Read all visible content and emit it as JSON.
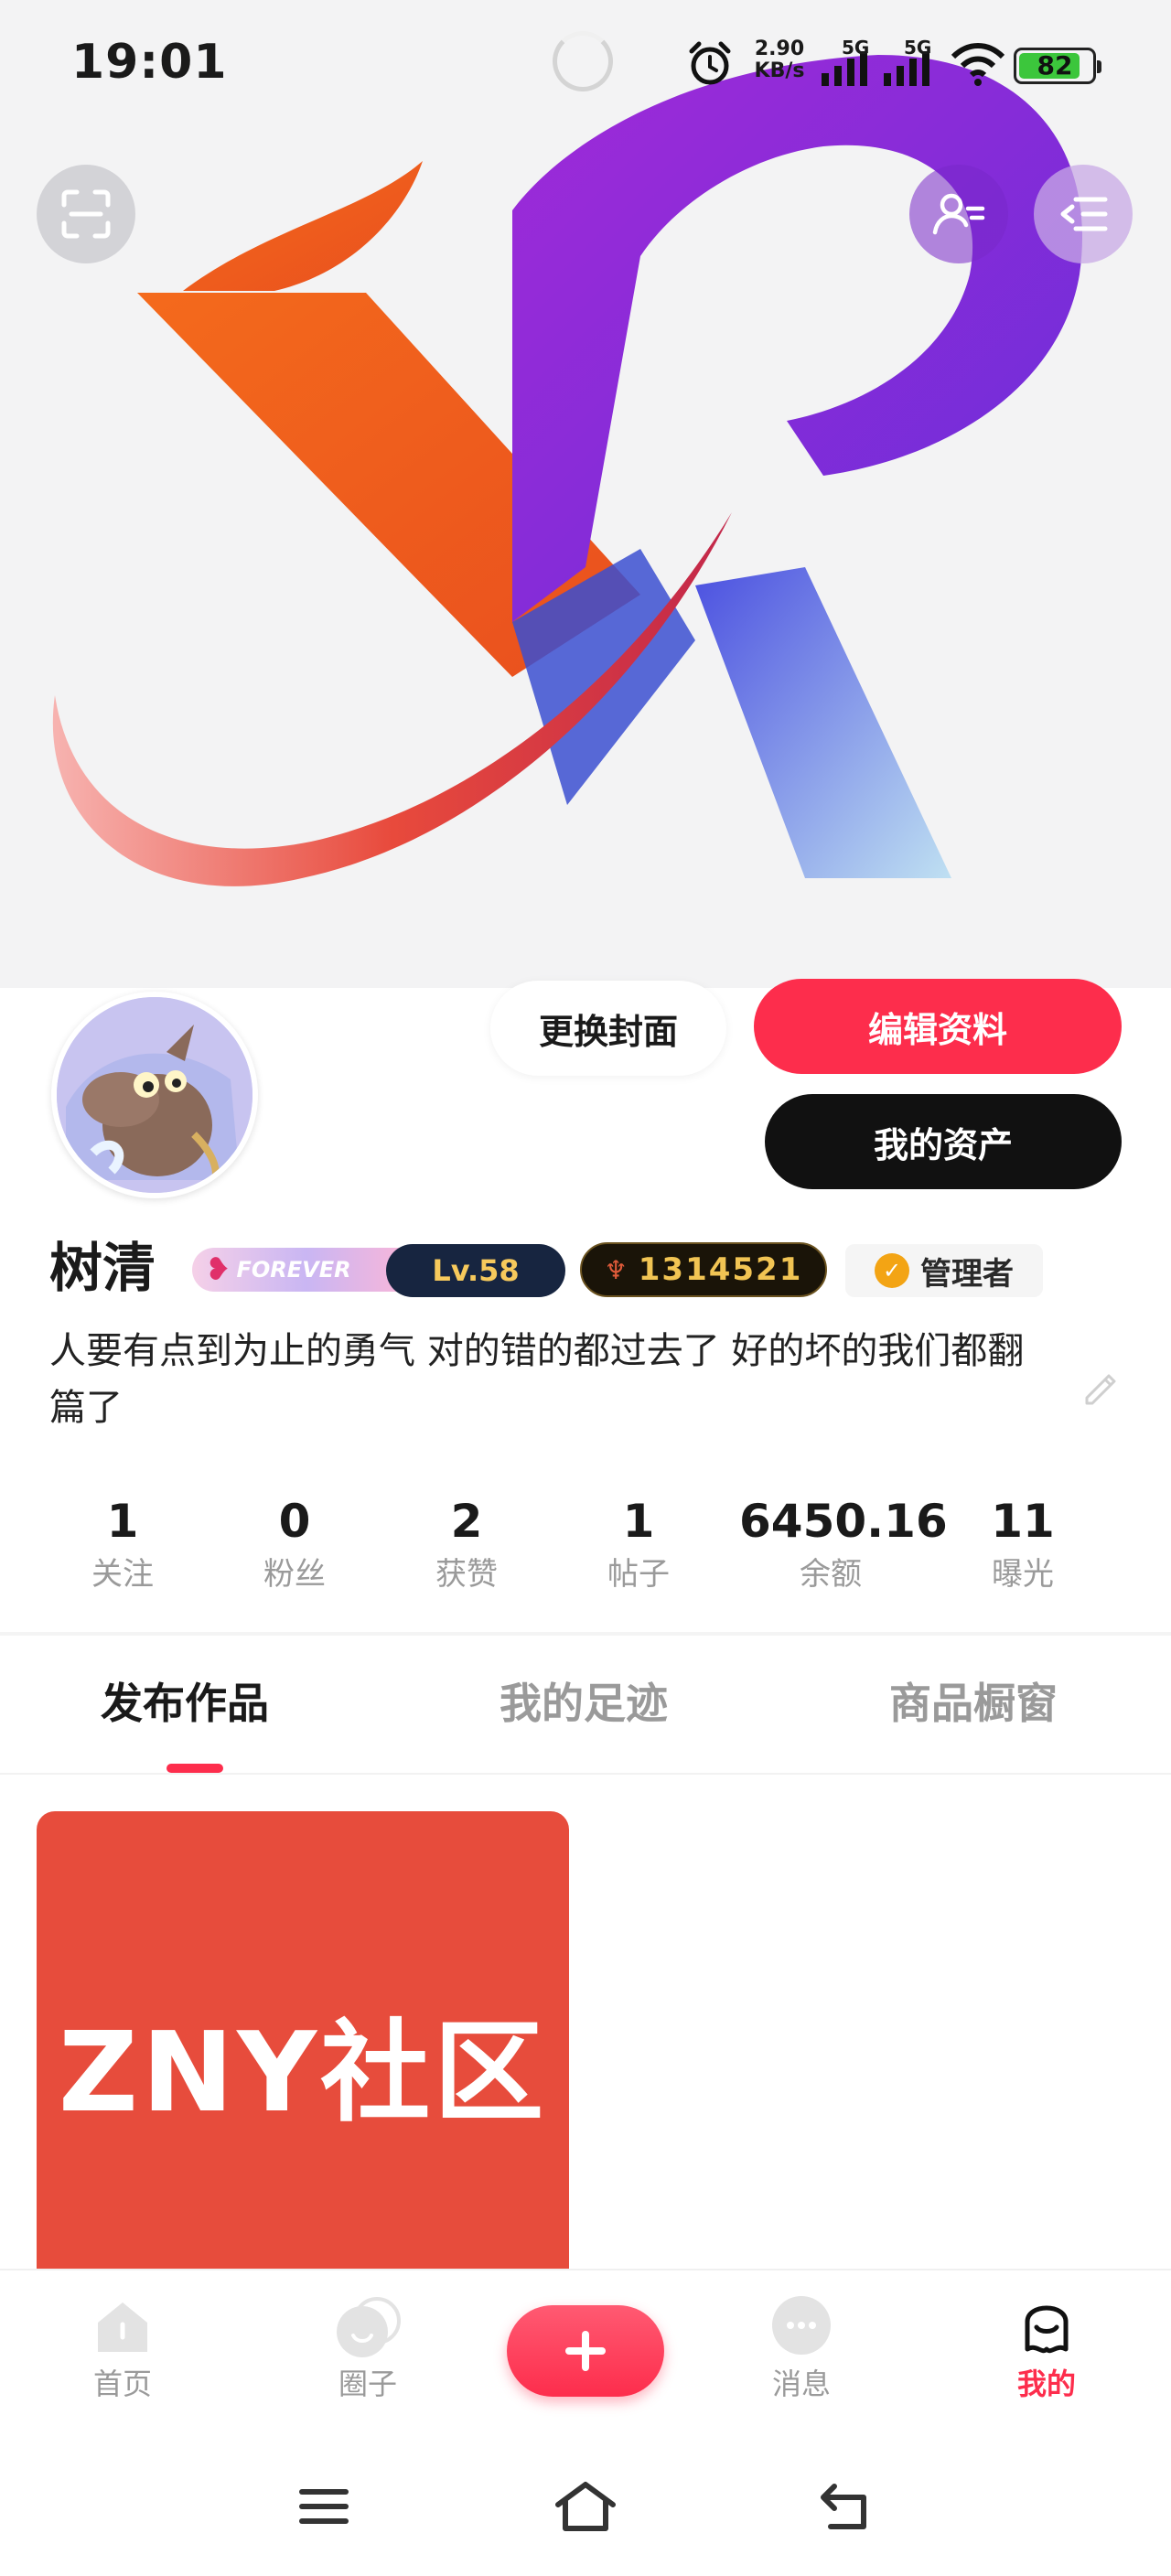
{
  "status_bar": {
    "time": "19:01",
    "net_speed_value": "2.90",
    "net_speed_unit": "KB/s",
    "signal1_label": "5G",
    "signal2_label": "5G",
    "battery": "82"
  },
  "cover": {
    "logo_icon": "xp-logo-icon",
    "scan_icon": "scan-icon",
    "contact_icon": "contacts-icon",
    "menu_icon": "menu-icon"
  },
  "actions": {
    "change_cover": "更换封面",
    "edit_profile": "编辑资料",
    "my_assets": "我的资产"
  },
  "profile": {
    "name": "树清",
    "badge_forever": "FOREVER",
    "level": "Lv.58",
    "uid": "1314521",
    "role": "管理者",
    "bio": "人要有点到为止的勇气 对的错的都过去了 好的坏的我们都翻篇了"
  },
  "stats": [
    {
      "value": "1",
      "label": "关注"
    },
    {
      "value": "0",
      "label": "粉丝"
    },
    {
      "value": "2",
      "label": "获赞"
    },
    {
      "value": "1",
      "label": "帖子"
    },
    {
      "value": "6450.16",
      "label": "余额"
    },
    {
      "value": "11",
      "label": "曝光"
    }
  ],
  "tabs": [
    {
      "label": "发布作品",
      "active": true
    },
    {
      "label": "我的足迹",
      "active": false
    },
    {
      "label": "商品橱窗",
      "active": false
    }
  ],
  "posts": [
    {
      "title": "ZNY社区"
    }
  ],
  "bottom_nav": [
    {
      "label": "首页",
      "icon": "home-icon"
    },
    {
      "label": "圈子",
      "icon": "circle-icon"
    },
    {
      "label": "消息",
      "icon": "message-icon"
    },
    {
      "label": "我的",
      "icon": "profile-icon",
      "active": true
    }
  ],
  "colors": {
    "accent": "#fd2d4c",
    "dark_button": "#111111",
    "post_card": "#e74c3c"
  }
}
